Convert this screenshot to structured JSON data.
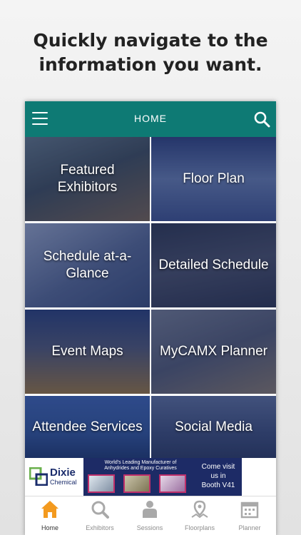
{
  "headline": {
    "line1": "Quickly navigate to the",
    "line2": "information you want."
  },
  "topbar": {
    "title": "HOME",
    "menu_icon": "hamburger-menu-icon",
    "search_icon": "search-icon",
    "color": "#0e7a74"
  },
  "tiles": [
    {
      "label": "Featured Exhibitors"
    },
    {
      "label": "Floor Plan"
    },
    {
      "label": "Schedule at-a-Glance"
    },
    {
      "label": "Detailed Schedule"
    },
    {
      "label": "Event Maps"
    },
    {
      "label": "MyCAMX Planner"
    },
    {
      "label": "Attendee Services"
    },
    {
      "label": "Social Media"
    }
  ],
  "ad": {
    "logo_word": "Dixie",
    "logo_sub": "Chemical",
    "tagline_1": "World's Leading Manufacturer of",
    "tagline_2": "Anhydrides and Epoxy Curatives",
    "cta_1": "Come visit",
    "cta_2": "us in",
    "cta_3": "Booth V41"
  },
  "nav": [
    {
      "label": "Home",
      "icon": "home-icon",
      "active": true
    },
    {
      "label": "Exhibitors",
      "icon": "magnifier-icon",
      "active": false
    },
    {
      "label": "Sessions",
      "icon": "people-icon",
      "active": false
    },
    {
      "label": "Floorplans",
      "icon": "map-pin-icon",
      "active": false
    },
    {
      "label": "Planner",
      "icon": "calendar-icon",
      "active": false
    }
  ],
  "colors": {
    "accent": "#f39a1f",
    "inactive_icon": "#a9a9a9",
    "ad_blue": "#1d2b66"
  }
}
